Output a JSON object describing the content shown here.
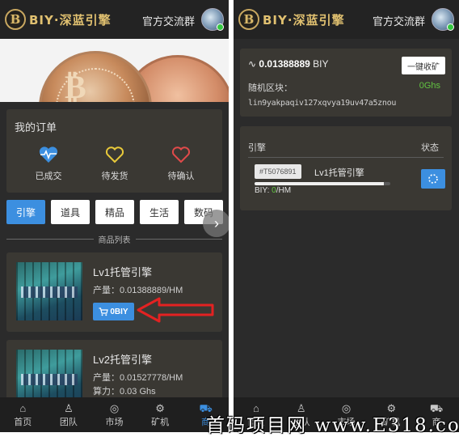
{
  "app": {
    "logo_text": "BIY·深蓝引擎",
    "logo_letter": "B"
  },
  "header": {
    "group_link": "官方交流群"
  },
  "orders": {
    "title": "我的订单",
    "items": [
      {
        "label": "已成交",
        "icon": "heartbeat-icon",
        "color": "#3c8fe0"
      },
      {
        "label": "待发货",
        "icon": "heart-outline-icon",
        "color": "#e8c93a"
      },
      {
        "label": "待确认",
        "icon": "heart-outline-icon",
        "color": "#e04a4a"
      }
    ]
  },
  "tabs": [
    {
      "label": "引擎",
      "active": true
    },
    {
      "label": "道具"
    },
    {
      "label": "精品"
    },
    {
      "label": "生活"
    },
    {
      "label": "数码"
    }
  ],
  "product_list": {
    "heading": "商品列表",
    "items": [
      {
        "name": "Lv1托管引擎",
        "output": "产量：0.01388889/HM",
        "buy_label": "0BIY"
      },
      {
        "name": "Lv2托管引擎",
        "output": "产量：0.01527778/HM",
        "power": "算力：0.03 Ghs"
      }
    ]
  },
  "bottom_nav": [
    {
      "label": "首页",
      "icon": "home-icon"
    },
    {
      "label": "团队",
      "icon": "team-icon"
    },
    {
      "label": "市场",
      "icon": "market-icon"
    },
    {
      "label": "矿机",
      "icon": "miner-icon"
    },
    {
      "label": "商",
      "icon": "cart-icon",
      "active": true
    }
  ],
  "right": {
    "mine": {
      "total": "0.01388889",
      "unit": "BIY",
      "collect_label": "一键收矿",
      "random_label": "随机区块：",
      "random_ghs": "0Ghs",
      "hash": "lin9yakpaqiv127xqvya19uv47a5znou"
    },
    "engines": {
      "col_engine": "引擎",
      "col_status": "状态",
      "row": {
        "id": "#T5076891",
        "name": "Lv1托管引擎",
        "progress": 0.95,
        "biy_label": "BIY:",
        "biy_value": "0",
        "biy_unit": "/HM"
      }
    }
  },
  "watermark": "首码项目网  www.E318.com"
}
